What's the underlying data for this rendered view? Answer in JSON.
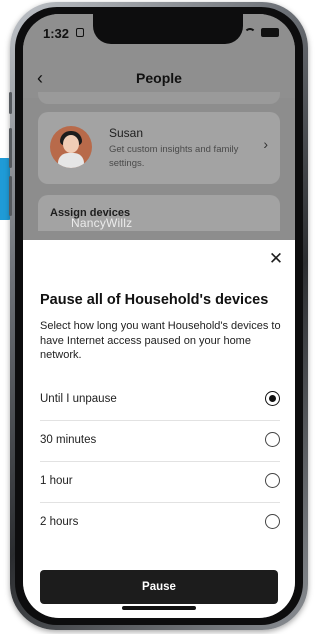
{
  "status_bar": {
    "time": "1:32"
  },
  "nav": {
    "back_glyph": "‹",
    "title": "People"
  },
  "person": {
    "name": "Susan",
    "description": "Get custom insights and family settings.",
    "chevron_glyph": "›"
  },
  "assign": {
    "label": "Assign devices"
  },
  "watermark": "NancyWillz",
  "sheet": {
    "close_glyph": "✕",
    "title": "Pause all of Household's devices",
    "description": "Select how long you want Household's devices to have Internet access paused on your home network.",
    "options": [
      {
        "label": "Until I unpause",
        "selected": true
      },
      {
        "label": "30 minutes",
        "selected": false
      },
      {
        "label": "1 hour",
        "selected": false
      },
      {
        "label": "2 hours",
        "selected": false
      }
    ],
    "button_label": "Pause"
  },
  "colors": {
    "accent_blue": "#1f9bd7",
    "button_dark": "#1c1c1c",
    "overlay": "#8f8f8f"
  },
  "icons": [
    "back-chevron-icon",
    "lock-icon",
    "signal-icon",
    "wifi-icon",
    "battery-icon",
    "chevron-right-icon",
    "close-icon"
  ]
}
